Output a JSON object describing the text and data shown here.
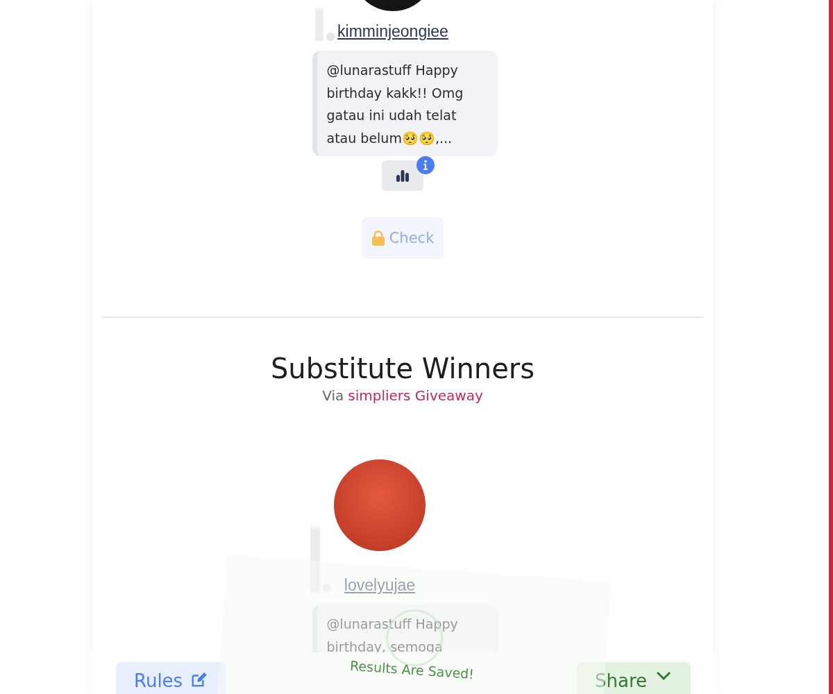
{
  "winners": [
    {
      "username": "kimminjeongiee",
      "comment": "@lunarastuff Happy birthday kakk!! Omg gatau ini udah telat atau belum🥺🥺,...",
      "check_button": {
        "label": "Check",
        "locked": true
      }
    }
  ],
  "substitute_section": {
    "title": "Substitute Winners",
    "via_prefix": "Via",
    "via_link": "simpliers Giveaway",
    "winners": [
      {
        "username": "lovelyujae",
        "comment": "@lunarastuff Happy birthday, semoga"
      }
    ]
  },
  "bottom_bar": {
    "buttons": [
      {
        "label": "Rules",
        "kind": "rules"
      },
      {
        "label": "Share",
        "kind": "share"
      }
    ]
  },
  "toast": {
    "title": "Results Are Saved!"
  }
}
